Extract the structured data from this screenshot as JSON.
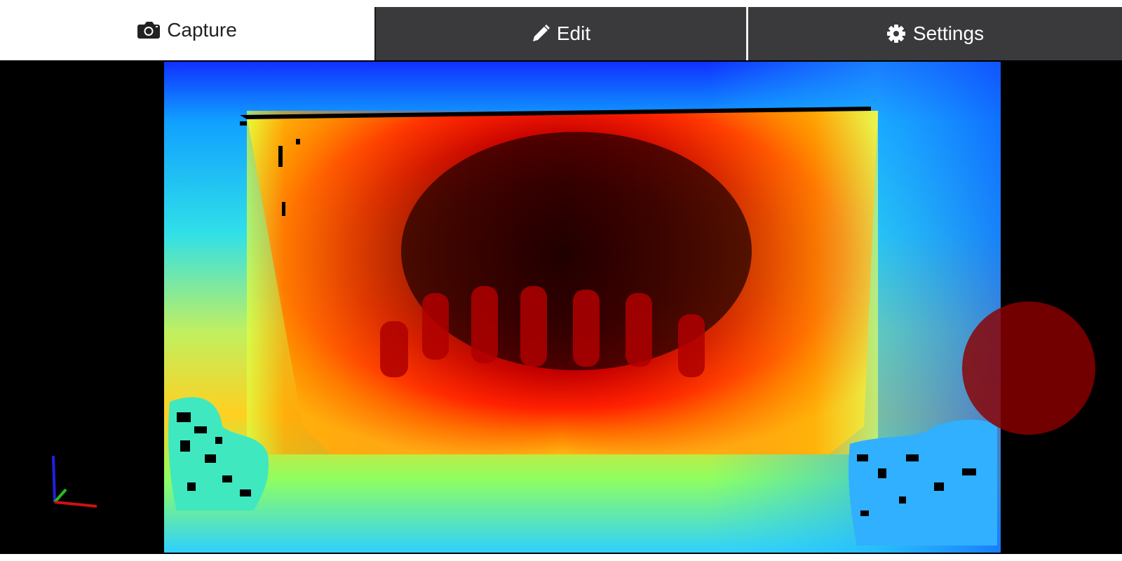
{
  "tabs": {
    "capture": {
      "label": "Capture",
      "icon": "camera-icon",
      "active": true
    },
    "edit": {
      "label": "Edit",
      "icon": "pencil-icon",
      "active": false
    },
    "settings": {
      "label": "Settings",
      "icon": "gear-icon",
      "active": false
    }
  },
  "viewport": {
    "view": "depth-colormap",
    "record_button_color": "#8b0000",
    "axis_colors": {
      "x": "#d01010",
      "y": "#20c020",
      "z": "#2020e0"
    }
  }
}
